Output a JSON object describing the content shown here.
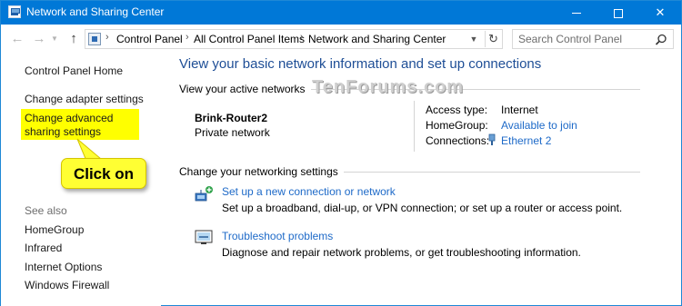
{
  "window": {
    "title": "Network and Sharing Center",
    "controls": {
      "minimize": "minimize-icon",
      "maximize": "maximize-icon",
      "close": "close-icon"
    }
  },
  "navigation": {
    "breadcrumbs": [
      "Control Panel",
      "All Control Panel Items",
      "Network and Sharing Center"
    ],
    "search_placeholder": "Search Control Panel"
  },
  "left_pane": {
    "home": "Control Panel Home",
    "links": [
      "Change adapter settings",
      "Change advanced sharing settings"
    ],
    "see_also_label": "See also",
    "see_also": [
      "HomeGroup",
      "Infrared",
      "Internet Options",
      "Windows Firewall"
    ]
  },
  "callout": {
    "text": "Click on",
    "color": "#ffff33"
  },
  "main": {
    "title": "View your basic network information and set up connections",
    "active_networks_label": "View your active networks",
    "network": {
      "name": "Brink-Router2",
      "type": "Private network",
      "access_type_label": "Access type:",
      "access_type": "Internet",
      "homegroup_label": "HomeGroup:",
      "homegroup": "Available to join",
      "connections_label": "Connections:",
      "connection": "Ethernet 2"
    },
    "change_settings_label": "Change your networking settings",
    "tasks": [
      {
        "link": "Set up a new connection or network",
        "desc": "Set up a broadband, dial-up, or VPN connection; or set up a router or access point.",
        "icon": "new-connection-icon"
      },
      {
        "link": "Troubleshoot problems",
        "desc": "Diagnose and repair network problems, or get troubleshooting information.",
        "icon": "troubleshoot-icon"
      }
    ]
  },
  "watermark": "TenForums.com",
  "colors": {
    "titlebar": "#0078d7",
    "link": "#1e6ac8",
    "heading": "#1e4e96",
    "highlight": "#ffff00"
  }
}
